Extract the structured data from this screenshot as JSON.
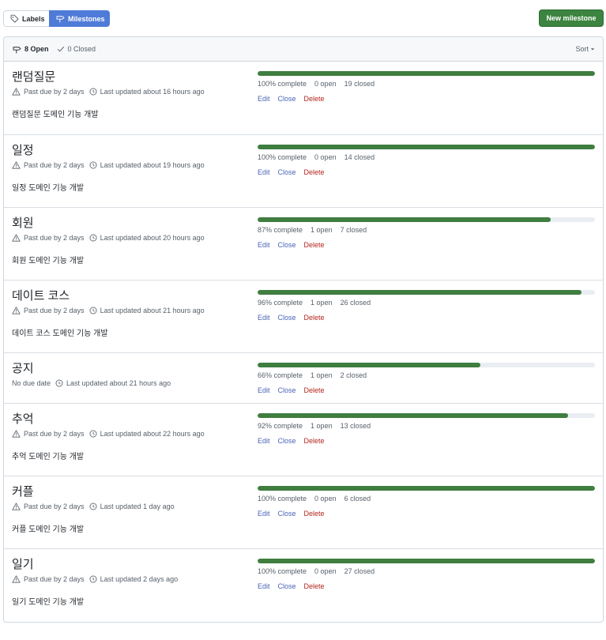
{
  "nav": {
    "labels_label": "Labels",
    "milestones_label": "Milestones",
    "new_milestone_label": "New milestone"
  },
  "header": {
    "open_label": "8 Open",
    "closed_label": "0 Closed",
    "sort_label": "Sort"
  },
  "actions": {
    "edit": "Edit",
    "close": "Close",
    "delete": "Delete"
  },
  "milestones": [
    {
      "title": "랜덤질문",
      "due": "Past due by 2 days",
      "updated": "Last updated about 16 hours ago",
      "description": "랜덤질문 도메인 기능 개발",
      "progress": 100,
      "percent_label": "100% complete",
      "open_label": "0 open",
      "closed_label": "19 closed"
    },
    {
      "title": "일정",
      "due": "Past due by 2 days",
      "updated": "Last updated about 19 hours ago",
      "description": "일정 도메인 기능 개발",
      "progress": 100,
      "percent_label": "100% complete",
      "open_label": "0 open",
      "closed_label": "14 closed"
    },
    {
      "title": "회원",
      "due": "Past due by 2 days",
      "updated": "Last updated about 20 hours ago",
      "description": "회원 도메인 기능 개발",
      "progress": 87,
      "percent_label": "87% complete",
      "open_label": "1 open",
      "closed_label": "7 closed"
    },
    {
      "title": "데이트 코스",
      "due": "Past due by 2 days",
      "updated": "Last updated about 21 hours ago",
      "description": "데이트 코스 도메인 기능 개발",
      "progress": 96,
      "percent_label": "96% complete",
      "open_label": "1 open",
      "closed_label": "26 closed"
    },
    {
      "title": "공지",
      "due": "No due date",
      "updated": "Last updated about 21 hours ago",
      "description": "",
      "progress": 66,
      "percent_label": "66% complete",
      "open_label": "1 open",
      "closed_label": "2 closed"
    },
    {
      "title": "추억",
      "due": "Past due by 2 days",
      "updated": "Last updated about 22 hours ago",
      "description": "추억 도메인 기능 개발",
      "progress": 92,
      "percent_label": "92% complete",
      "open_label": "1 open",
      "closed_label": "13 closed"
    },
    {
      "title": "커플",
      "due": "Past due by 2 days",
      "updated": "Last updated 1 day ago",
      "description": "커플 도메인 기능 개발",
      "progress": 100,
      "percent_label": "100% complete",
      "open_label": "0 open",
      "closed_label": "6 closed"
    },
    {
      "title": "일기",
      "due": "Past due by 2 days",
      "updated": "Last updated 2 days ago",
      "description": "일기 도메인 기능 개발",
      "progress": 100,
      "percent_label": "100% complete",
      "open_label": "0 open",
      "closed_label": "27 closed"
    }
  ],
  "colors": {
    "progress_fill": "#3f7e3f",
    "primary_button": "#3c8440",
    "selected_tab": "#4f7bd8",
    "link": "#4a64b8",
    "danger": "#b3261e"
  }
}
